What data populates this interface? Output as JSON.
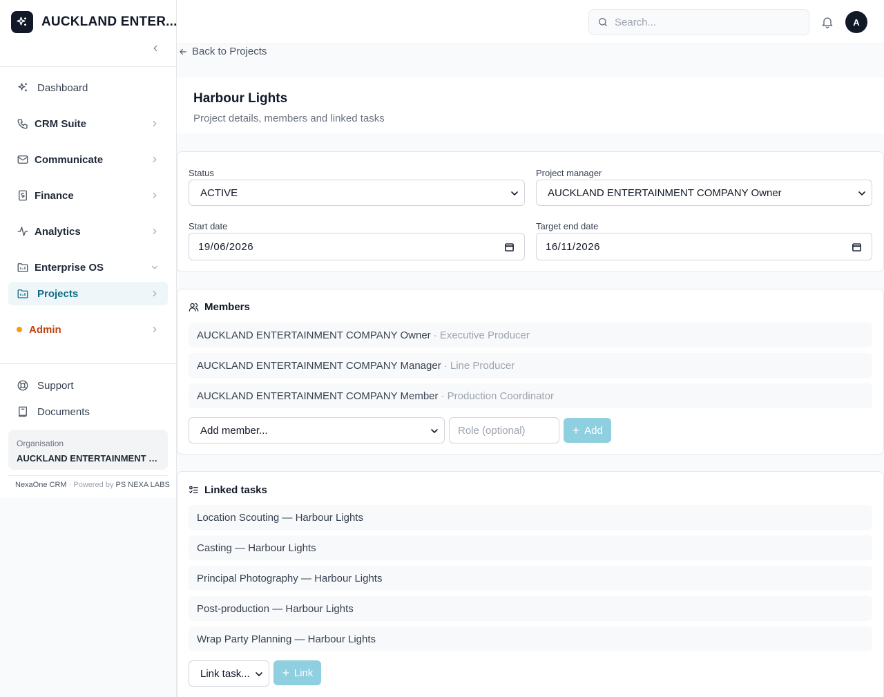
{
  "app": {
    "brand_name": "AUCKLAND ENTER...",
    "collapse_label": "Collapse sidebar"
  },
  "sidebar": {
    "items": [
      {
        "label": "Dashboard",
        "icon": "sparkle-icon"
      },
      {
        "label": "CRM Suite",
        "icon": "phone-icon"
      },
      {
        "label": "Communicate",
        "icon": "mail-icon"
      },
      {
        "label": "Finance",
        "icon": "receipt-icon"
      },
      {
        "label": "Analytics",
        "icon": "activity-icon"
      },
      {
        "label": "Enterprise OS",
        "icon": "building-icon",
        "expanded": true
      },
      {
        "label": "Projects",
        "icon": "folder-kanban-icon",
        "active": true
      },
      {
        "label": "Admin",
        "icon": "status-dot"
      }
    ],
    "bottom": [
      {
        "label": "Support",
        "icon": "lifebuoy-icon"
      },
      {
        "label": "Documents",
        "icon": "book-icon"
      }
    ],
    "org_label": "Organisation",
    "org_name": "AUCKLAND ENTERTAINMENT COMPANY",
    "footer_product": "NexaOne CRM",
    "footer_sep": "·",
    "footer_powered": "Powered by",
    "footer_company": "PS NEXA LABS"
  },
  "topbar": {
    "search_placeholder": "Search...",
    "avatar_initial": "A"
  },
  "page": {
    "back_label": "Back to Projects",
    "title": "Harbour Lights",
    "subtitle": "Project details, members and linked tasks"
  },
  "details": {
    "status_label": "Status",
    "status_value": "ACTIVE",
    "manager_label": "Project manager",
    "manager_value": "AUCKLAND ENTERTAINMENT COMPANY Owner",
    "start_label": "Start date",
    "start_value": "19/06/2026",
    "end_label": "Target end date",
    "end_value": "16/11/2026"
  },
  "members": {
    "heading": "Members",
    "list": [
      {
        "name": "AUCKLAND ENTERTAINMENT COMPANY Owner",
        "role": "· Executive Producer"
      },
      {
        "name": "AUCKLAND ENTERTAINMENT COMPANY Manager",
        "role": "· Line Producer"
      },
      {
        "name": "AUCKLAND ENTERTAINMENT COMPANY Member",
        "role": "· Production Coordinator"
      }
    ],
    "add_select": "Add member...",
    "role_placeholder": "Role (optional)",
    "add_button": "Add"
  },
  "tasks": {
    "heading": "Linked tasks",
    "list": [
      "Location Scouting — Harbour Lights",
      "Casting — Harbour Lights",
      "Principal Photography — Harbour Lights",
      "Post-production — Harbour Lights",
      "Wrap Party Planning — Harbour Lights"
    ],
    "link_select": "Link task...",
    "link_button": "Link"
  },
  "colors": {
    "accent": "#0e6b86",
    "active_bg": "#eef6f9",
    "button_disabled": "#8ecfe0",
    "admin": "#c2410c",
    "admin_dot": "#f59e0b"
  }
}
